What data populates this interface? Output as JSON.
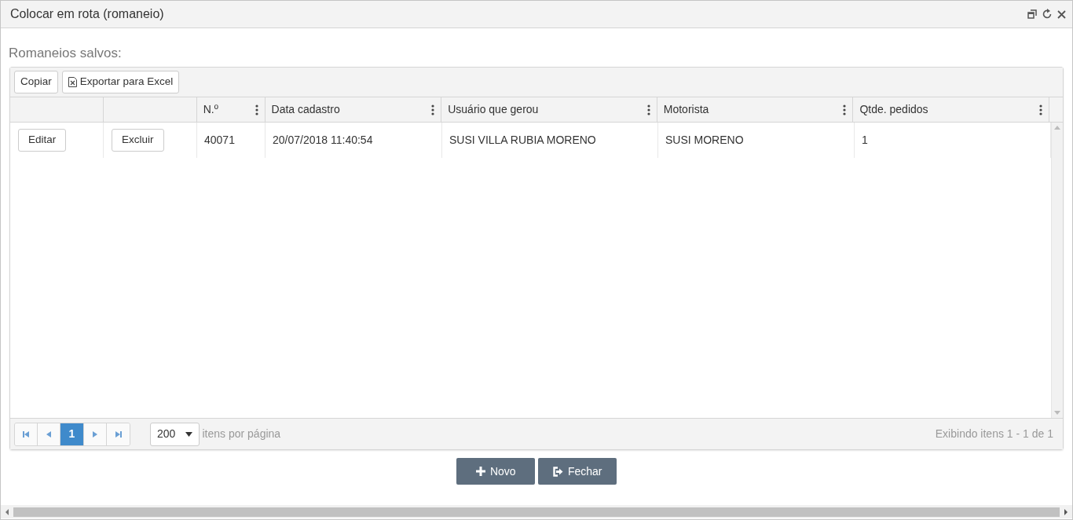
{
  "window": {
    "title": "Colocar em rota (romaneio)"
  },
  "section_label": "Romaneios salvos:",
  "toolbar": [
    {
      "label": "Copiar",
      "kind": "plain"
    },
    {
      "label": "Exportar para Excel",
      "kind": "excel"
    }
  ],
  "table": {
    "columns": [
      "",
      "",
      "N.º",
      "Data cadastro",
      "Usuário que gerou",
      "Motorista",
      "Qtde. pedidos"
    ],
    "rows": [
      {
        "cells": [
          {
            "kind": "button",
            "text": "Editar"
          },
          {
            "kind": "button",
            "text": "Excluir"
          },
          {
            "kind": "text",
            "text": "40071"
          },
          {
            "kind": "text",
            "text": "20/07/2018 11:40:54"
          },
          {
            "kind": "text",
            "text": "SUSI VILLA RUBIA MORENO"
          },
          {
            "kind": "text",
            "text": "SUSI MORENO"
          },
          {
            "kind": "text",
            "text": "1"
          }
        ]
      }
    ]
  },
  "pager": {
    "pages": [
      {
        "label": "1",
        "selected": true
      }
    ],
    "page_size": "200",
    "page_size_label": "itens por página",
    "summary": "Exibindo itens 1 - 1 de 1"
  },
  "actions": [
    {
      "label": "Novo",
      "kind": "add"
    },
    {
      "label": "Fechar",
      "kind": "exit"
    }
  ]
}
